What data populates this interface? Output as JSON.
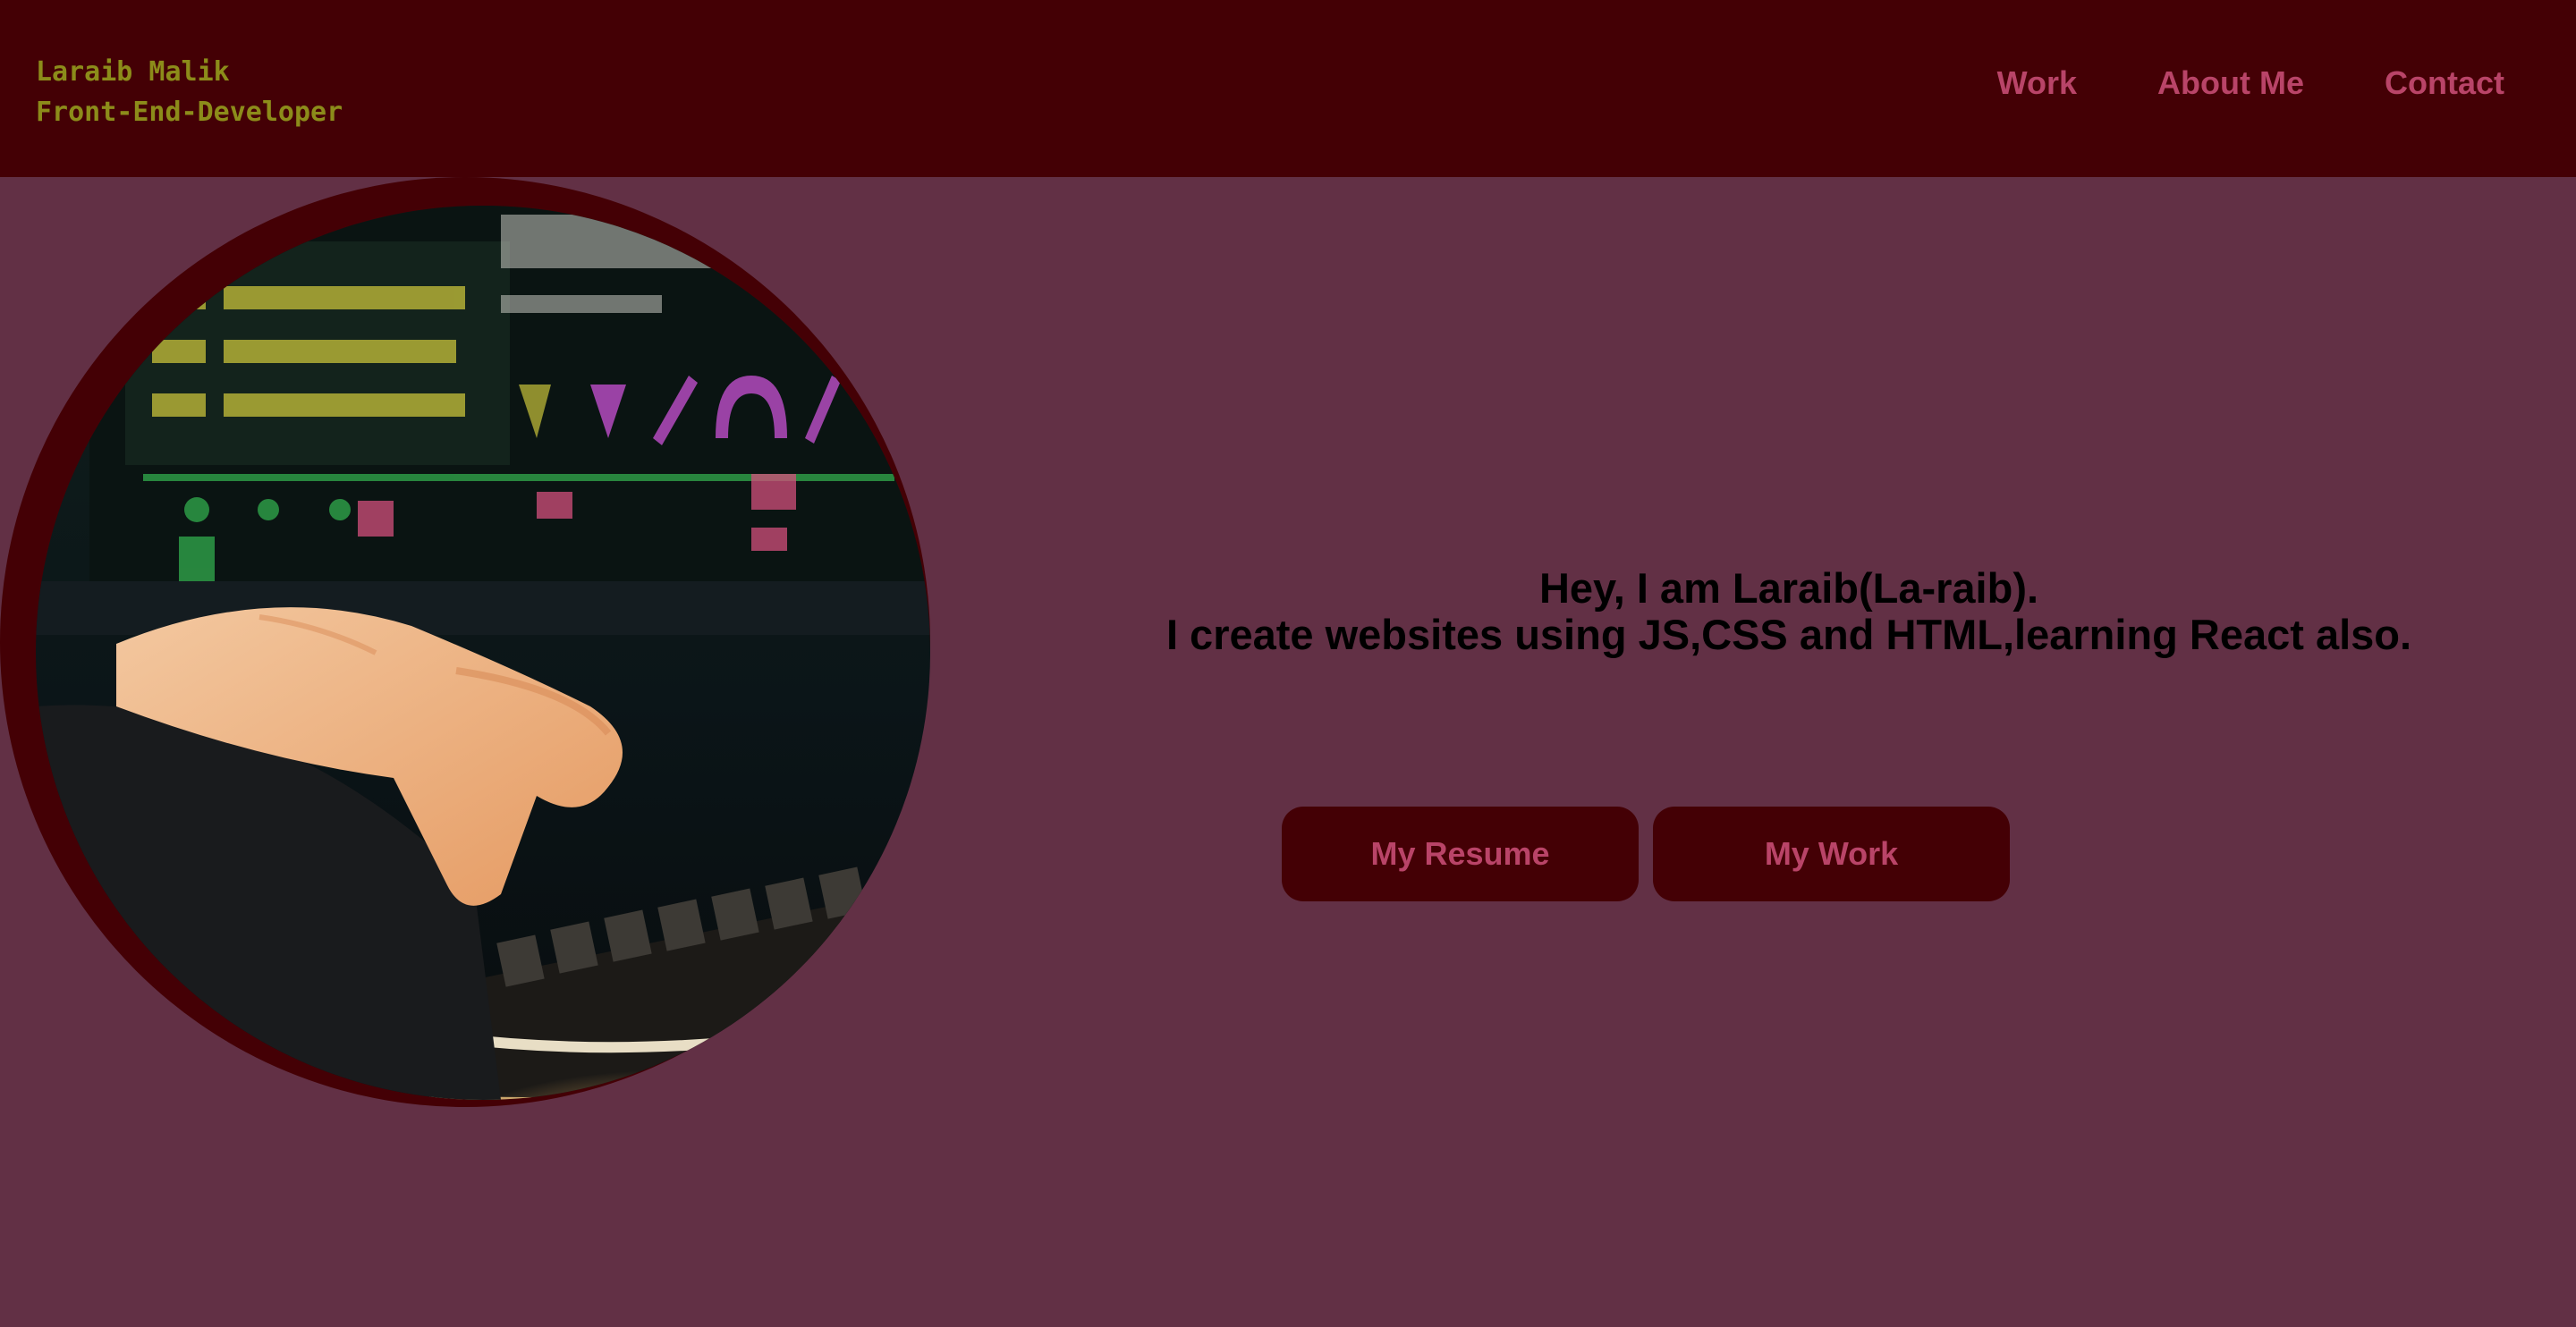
{
  "header": {
    "name": "Laraib Malik",
    "role": "Front-End-Developer",
    "nav": [
      {
        "label": "Work"
      },
      {
        "label": "About Me"
      },
      {
        "label": "Contact"
      }
    ]
  },
  "hero": {
    "image_icon": "typing-on-keyboard-photo",
    "greeting": "Hey, I am Laraib(La-raib).",
    "tagline": "I create websites using JS,CSS and HTML,learning React also."
  },
  "buttons": {
    "resume": "My Resume",
    "work": "My Work"
  },
  "colors": {
    "background": "#623045",
    "header": "#440005",
    "accent": "#b94468",
    "brand_text": "#8c8c1a"
  }
}
